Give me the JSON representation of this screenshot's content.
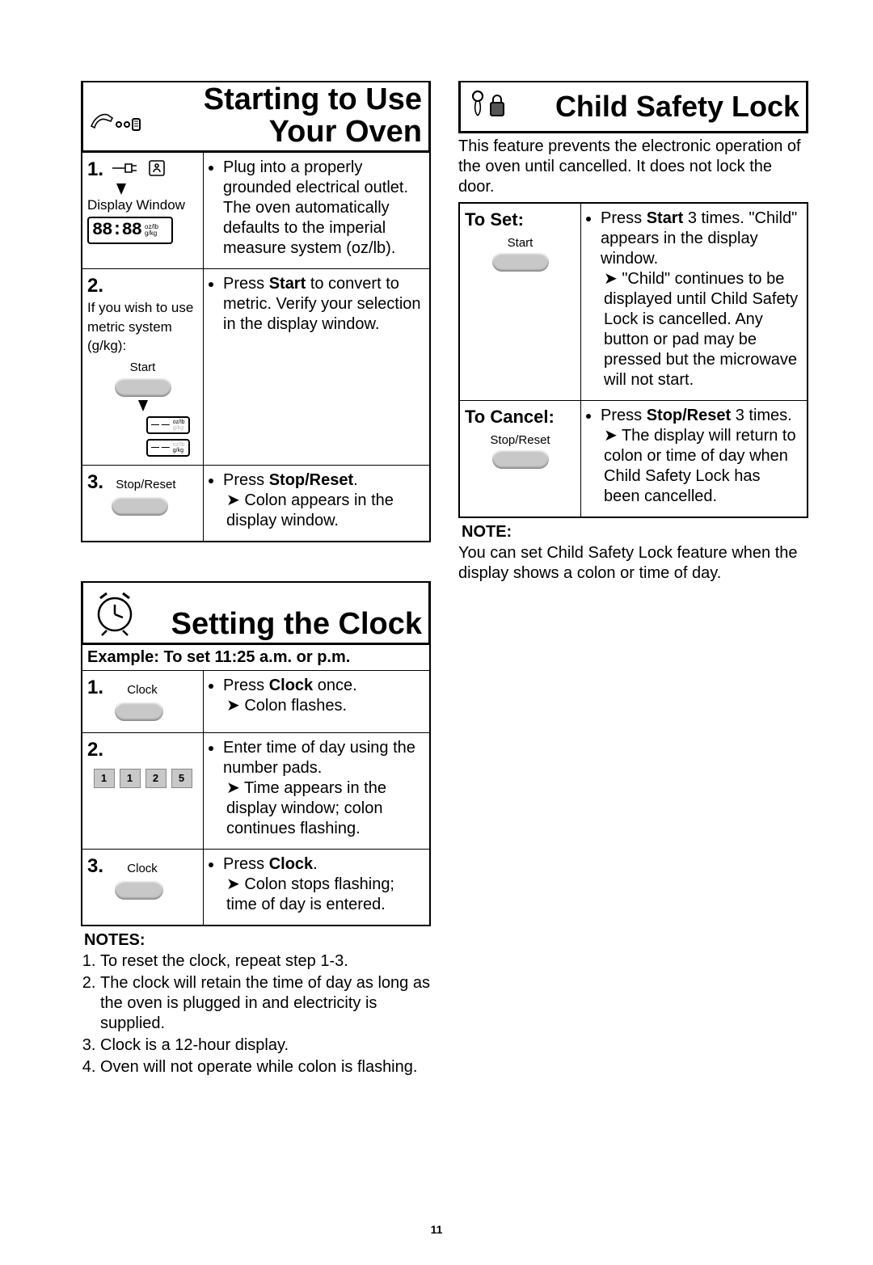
{
  "page_number": "11",
  "left_column": {
    "section1": {
      "icon": "hand-pressing-buttons-icon",
      "title": "Starting to Use\nYour Oven",
      "steps": [
        {
          "num": "1.",
          "left_label": "Display Window",
          "display_digits": "88:88",
          "display_units_top": "oz/lb",
          "display_units_bot": "g/kg",
          "right": [
            "Plug into a properly grounded electrical outlet.",
            "The oven automatically defaults to the imperial measure system (oz/lb)."
          ]
        },
        {
          "num": "2.",
          "left_text": "If you wish to use metric system (g/kg):",
          "button_label": "Start",
          "right": [
            "Press <b>Start</b> to convert to metric. Verify your selection in the display window."
          ]
        },
        {
          "num": "3.",
          "button_label": "Stop/Reset",
          "right": [
            "Press <b>Stop/Reset</b>.",
            "➤Colon appears in the display window."
          ]
        }
      ]
    },
    "section2": {
      "icon": "alarm-clock-icon",
      "title": "Setting the Clock",
      "example": "Example: To set 11:25 a.m. or p.m.",
      "steps": [
        {
          "num": "1.",
          "button_label": "Clock",
          "right": [
            "Press <b>Clock</b> once.",
            "➤Colon flashes."
          ]
        },
        {
          "num": "2.",
          "keys": [
            "1",
            "1",
            "2",
            "5"
          ],
          "right": [
            "Enter time of day using the number pads.",
            "➤Time appears in the display window; colon continues flashing."
          ]
        },
        {
          "num": "3.",
          "button_label": "Clock",
          "right": [
            "Press <b>Clock</b>.",
            "➤Colon stops flashing; time of day is entered."
          ]
        }
      ],
      "notes_heading": "NOTES:",
      "notes": [
        "To reset the clock, repeat step 1-3.",
        "The clock will retain the time of day as long as the oven is plugged in and electricity is supplied.",
        "Clock is a 12-hour display.",
        "Oven will not operate while colon is flashing."
      ]
    }
  },
  "right_column": {
    "section3": {
      "icon": "child-lock-icon",
      "title": "Child Safety Lock",
      "intro": "This feature prevents the electronic operation of the oven until cancelled. It does not lock the door.",
      "rows": [
        {
          "label": "To Set:",
          "button_label": "Start",
          "right": [
            "Press <b>Start</b> 3 times. \"Child\" appears in the display window.",
            "➤\"Child\" continues to be displayed until Child Safety Lock is cancelled. Any button or pad may be pressed but the microwave will not start."
          ]
        },
        {
          "label": "To Cancel:",
          "button_label": "Stop/Reset",
          "right": [
            "Press <b>Stop/Reset</b> 3 times.",
            "➤The display will return to colon or time of day when Child Safety Lock has been cancelled."
          ]
        }
      ],
      "note_heading": "NOTE:",
      "note": "You can set Child Safety Lock feature when the display shows a colon or time of day."
    }
  }
}
